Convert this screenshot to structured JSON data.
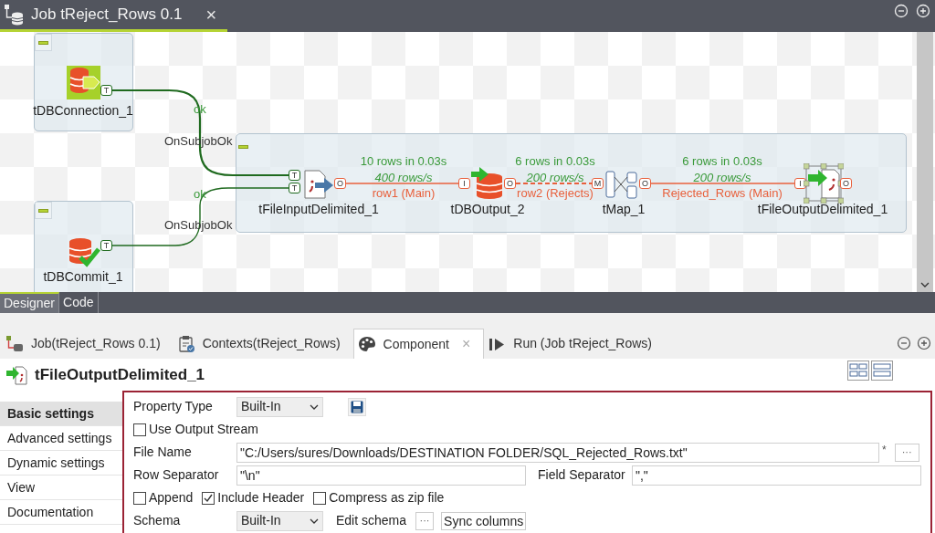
{
  "editor_tab": {
    "title": "Job tReject_Rows 0.1",
    "close": "×",
    "selected": true
  },
  "canvas": {
    "components": [
      {
        "label": "tDBConnection_1",
        "kind": "db-connection",
        "selected": false
      },
      {
        "label": "tDBCommit_1",
        "kind": "db-commit",
        "selected": false
      },
      {
        "label": "tFileInputDelimited_1",
        "kind": "file-input",
        "selected": false
      },
      {
        "label": "tDBOutput_2",
        "kind": "db-output",
        "selected": false
      },
      {
        "label": "tMap_1",
        "kind": "map",
        "selected": false
      },
      {
        "label": "tFileOutputDelimited_1",
        "kind": "file-output",
        "selected": true,
        "out_port": "O"
      }
    ],
    "triggers": [
      {
        "out_port": "T",
        "in_port": "T",
        "label": "ok",
        "subjob_label": "OnSubjobOk"
      },
      {
        "out_port": "T",
        "in_port": "T",
        "label": "ok",
        "subjob_label": "OnSubjobOk"
      }
    ],
    "flows": [
      {
        "out_port": "O",
        "in_port": "I",
        "stats": "10 rows in 0.03s",
        "rate": "400 rows/s",
        "label": "row1 (Main)",
        "kind": "main"
      },
      {
        "out_port": "O",
        "in_port": "M",
        "stats": "6 rows in 0.03s",
        "rate": "200 rows/s",
        "label": "row2 (Rejects)",
        "kind": "reject"
      },
      {
        "out_port": "O",
        "in_port": "I",
        "stats": "6 rows in 0.03s",
        "rate": "200 rows/s",
        "label": "Rejected_Rows (Main)",
        "kind": "main"
      }
    ]
  },
  "editor_views": [
    {
      "label": "Designer",
      "selected": true
    },
    {
      "label": "Code",
      "selected": false
    }
  ],
  "view_tabs": [
    {
      "label": "Job(tReject_Rows 0.1)",
      "kind": "job",
      "selected": false
    },
    {
      "label": "Contexts(tReject_Rows)",
      "kind": "contexts",
      "selected": false
    },
    {
      "label": "Component",
      "kind": "component",
      "selected": true,
      "close": "×"
    },
    {
      "label": "Run (Job tReject_Rows)",
      "kind": "run",
      "selected": false
    }
  ],
  "component_title": "tFileOutputDelimited_1",
  "settings_nav": [
    {
      "label": "Basic settings",
      "selected": true
    },
    {
      "label": "Advanced settings",
      "selected": false
    },
    {
      "label": "Dynamic settings",
      "selected": false
    },
    {
      "label": "View",
      "selected": false
    },
    {
      "label": "Documentation",
      "selected": false
    }
  ],
  "form": {
    "property_type": {
      "label": "Property Type",
      "value": "Built-In"
    },
    "use_output_stream": {
      "label": "Use Output Stream",
      "checked": false
    },
    "file_name": {
      "label": "File Name",
      "value": "\"C:/Users/sures/Downloads/DESTINATION FOLDER/SQL_Rejected_Rows.txt\"",
      "required_mark": "*",
      "browse": "···"
    },
    "row_separator": {
      "label": "Row Separator",
      "value": "\"\\n\""
    },
    "field_separator": {
      "label": "Field Separator",
      "value": "\",\""
    },
    "options": [
      {
        "label": "Append",
        "checked": false
      },
      {
        "label": "Include Header",
        "checked": true
      },
      {
        "label": "Compress as zip file",
        "checked": false
      }
    ],
    "schema": {
      "label": "Schema",
      "value": "Built-In",
      "edit_label": "Edit schema",
      "edit_button": "···",
      "sync_button": "Sync columns"
    }
  }
}
